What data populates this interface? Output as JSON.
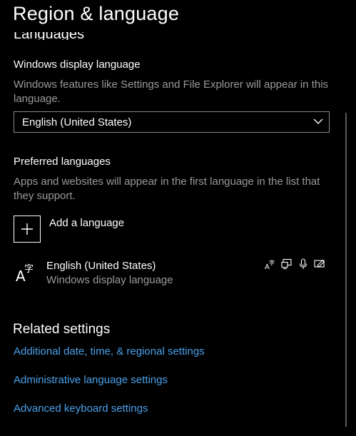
{
  "header": {
    "title": "Region & language",
    "section_heading": "Languages"
  },
  "display_language": {
    "label": "Windows display language",
    "description": "Windows features like Settings and File Explorer will appear in this language.",
    "selected": "English (United States)"
  },
  "preferred": {
    "label": "Preferred languages",
    "description": "Apps and websites will appear in the first language in the list that they support.",
    "add_label": "Add a language",
    "languages": [
      {
        "name": "English (United States)",
        "subtitle": "Windows display language",
        "features": [
          "language-pack-icon",
          "display-icon",
          "speech-icon",
          "handwriting-icon"
        ]
      }
    ]
  },
  "related": {
    "title": "Related settings",
    "links": [
      "Additional date, time, & regional settings",
      "Administrative language settings",
      "Advanced keyboard settings"
    ]
  },
  "colors": {
    "background": "#000000",
    "link": "#4aa0ea",
    "secondary_text": "#9a9a9a"
  }
}
